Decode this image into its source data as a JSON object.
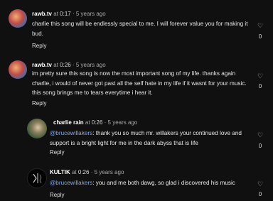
{
  "comments": [
    {
      "username": "rawb.tv",
      "at": "at",
      "time": "0:17",
      "sep": "·",
      "ago": "5 years ago",
      "text": "charlie this song will be endlessly special to me. I will forever value you for making it bud.",
      "mention": "",
      "reply": "Reply",
      "likes": "0"
    },
    {
      "username": "rawb.tv",
      "at": "at",
      "time": "0:26",
      "sep": "·",
      "ago": "5 years ago",
      "text": "im pretty sure this song is now the most important song of my life. thanks again charlie, i would of never got past all the self hate in my life if it wasnt for your music. this song brings me to tears everytime i hear it.",
      "mention": "",
      "reply": "Reply",
      "likes": "0"
    },
    {
      "username": "charlie rain",
      "at": "at",
      "time": "0:26",
      "sep": "·",
      "ago": "5 years ago",
      "mention": "@brucewillakers",
      "text": ": thank you so much mr. willakers your continued love and support is a bright light for me in the dark abyss that is life",
      "reply": "Reply",
      "likes": "0"
    },
    {
      "username": "KULTIK",
      "at": "at",
      "time": "0:26",
      "sep": "·",
      "ago": "5 years ago",
      "mention": "@brucewillakers",
      "text": ": you and me both dawg, so glad i discovered his music",
      "reply": "Reply",
      "likes": "0"
    }
  ],
  "icons": {
    "like": "heart-outline-icon"
  }
}
